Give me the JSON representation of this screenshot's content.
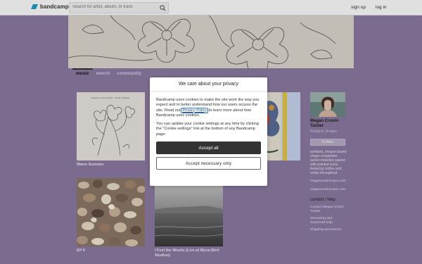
{
  "topbar": {
    "logo_text": "bandcamp",
    "search_placeholder": "Search for artist, album, or track",
    "signup_label": "sign up",
    "login_label": "log in"
  },
  "tabs": [
    {
      "label": "music",
      "active": true
    },
    {
      "label": "merch",
      "active": false
    },
    {
      "label": "community",
      "active": false
    }
  ],
  "albums": [
    {
      "title": "Warm Summer",
      "cover_caption": "Megan Cronin Tucker - Warm Summer"
    },
    {
      "title": ""
    },
    {
      "title": "EP II"
    },
    {
      "title": "I Feel the Words (Live at Myna Bird Studios)"
    }
  ],
  "artist": {
    "name": "Megan Cronin Tucker",
    "location": "Portland, Oregon",
    "follow_label": "Follow",
    "bio": "portland, oregon based singer-songwriter. sweet melodies paired with painted lyrics, featuring violins and violas throughout.",
    "links": [
      "megancroninmusic.com",
      "megancroninmusic.com"
    ],
    "contact_heading": "contact / help",
    "contact_items": [
      "Contact Megan Cronin Tucker",
      "Streaming and Download help",
      "Shipping and returns"
    ]
  },
  "cookie_dialog": {
    "title": "We care about your privacy",
    "p1_before": "Bandcamp uses cookies to make the site work the way you expect and to better understand how our users access the site. Read our ",
    "p1_link": "Privacy Policy",
    "p1_after": " to learn more about how Bandcamp uses cookies.",
    "p2": "You can update your cookie settings at any time by clicking the \"Cookie settings\" link at the bottom of any Bandcamp page.",
    "accept_all_label": "Accept all",
    "accept_necessary_label": "Accept necessary only"
  },
  "colors": {
    "page_bg": "#8c7ba3",
    "overlay": "rgba(0,0,0,0.12)",
    "accept_button": "#333333",
    "logo_accent": "#1da0c3"
  }
}
